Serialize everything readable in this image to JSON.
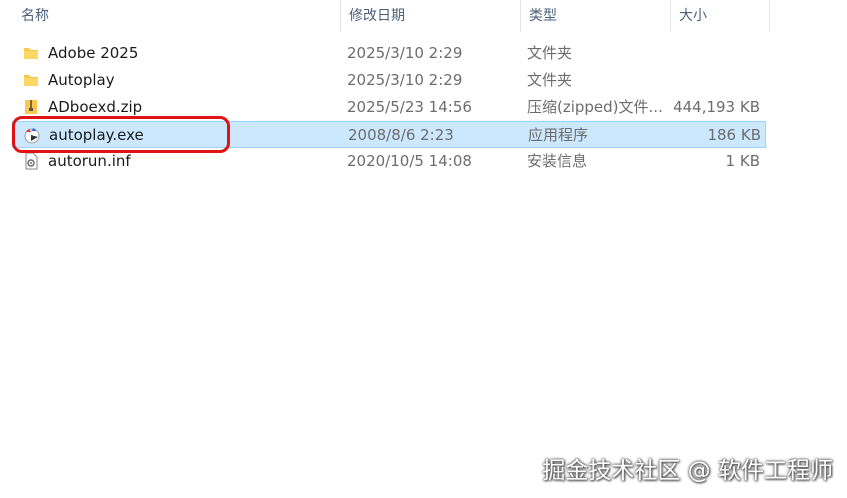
{
  "columns": {
    "name": "名称",
    "date": "修改日期",
    "type": "类型",
    "size": "大小"
  },
  "sort_indicator": "^",
  "files": [
    {
      "name": "Adobe 2025",
      "date": "2025/3/10 2:29",
      "type": "文件夹",
      "size": "",
      "icon": "folder-icon"
    },
    {
      "name": "Autoplay",
      "date": "2025/3/10 2:29",
      "type": "文件夹",
      "size": "",
      "icon": "folder-icon"
    },
    {
      "name": "ADboexd.zip",
      "date": "2025/5/23 14:56",
      "type": "压缩(zipped)文件...",
      "size": "444,193 KB",
      "icon": "zip-folder-icon"
    },
    {
      "name": "autoplay.exe",
      "date": "2008/8/6 2:23",
      "type": "应用程序",
      "size": "186 KB",
      "icon": "autoplay-app-icon",
      "selected": true
    },
    {
      "name": "autorun.inf",
      "date": "2020/10/5 14:08",
      "type": "安装信息",
      "size": "1 KB",
      "icon": "inf-file-icon"
    }
  ],
  "watermark": "掘金技术社区 @ 软件工程师",
  "colors": {
    "selection_bg": "#cce8ff",
    "selection_border": "#99d1ff",
    "highlight_ring": "#e01414",
    "folder": "#f8c94a"
  }
}
